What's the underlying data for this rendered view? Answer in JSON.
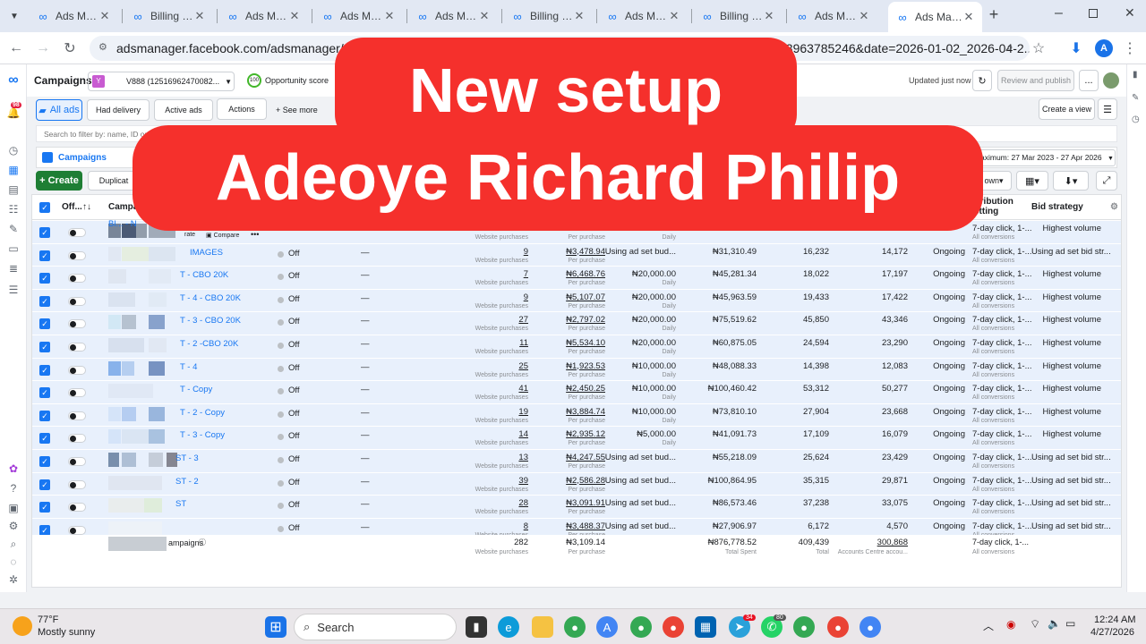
{
  "browser": {
    "tabs": [
      {
        "label": "Ads Manag",
        "icon": "meta-icon",
        "active": false
      },
      {
        "label": "Billing & p",
        "icon": "meta-icon",
        "active": false
      },
      {
        "label": "Ads Manag",
        "icon": "meta-icon",
        "active": false
      },
      {
        "label": "Ads Manag",
        "icon": "meta-icon",
        "active": false
      },
      {
        "label": "Ads Manag",
        "icon": "meta-icon",
        "active": false
      },
      {
        "label": "Billing & p",
        "icon": "meta-icon",
        "active": false
      },
      {
        "label": "Ads Manag",
        "icon": "meta-icon",
        "active": false
      },
      {
        "label": "Billing & p",
        "icon": "meta-icon",
        "active": false
      },
      {
        "label": "Ads Manag",
        "icon": "meta-icon",
        "active": false
      },
      {
        "label": "Ads Mana",
        "icon": "meta-icon",
        "active": true
      }
    ],
    "url": "adsmanager.facebook.com/adsmanager/manage/",
    "url_tail": "23963785246&date=2026-01-02_2026-04-2...",
    "profile_initial": "A"
  },
  "header": {
    "title": "Campaigns",
    "account_badge": "Y",
    "account": "V888 (12516962470082...",
    "opportunity_score_value": "100",
    "opportunity_score_label": "Opportunity score",
    "updated": "Updated just now",
    "review_publish": "Review and publish",
    "more": "..."
  },
  "toolbar": {
    "all_ads": "All ads",
    "had_delivery": "Had delivery",
    "active_ads": "Active ads",
    "actions": "Actions",
    "see_more": "See more",
    "create_view": "Create a view",
    "search_placeholder": "Search to filter by: name, ID or m",
    "campaigns_tab": "Campaigns",
    "date_range": "aximum: 27 Mar 2023 - 27 Apr 2026",
    "create": "Create",
    "duplicate": "Duplicat",
    "breakdown": "own"
  },
  "table": {
    "headers": {
      "off": "Off...",
      "campaign": "Campaig",
      "attribution_1": "ttribution",
      "attribution_2": "etting",
      "bid_strategy": "Bid strategy"
    },
    "rows": [
      {
        "name": "Bl... - N",
        "delivery": "",
        "results": "",
        "results_sub": "Website purchases",
        "cpr": "",
        "cpr_sub": "Per purchase",
        "budget": "",
        "budget_sub": "Daily",
        "spent": "",
        "impr": "",
        "reach": "",
        "ends": "",
        "attribution": "7-day click, 1-...",
        "attr_sub": "All conversions",
        "bid": "Highest volume",
        "hover": true,
        "compare": "Compare",
        "duplicate_hint": "rate"
      },
      {
        "name": "IMAGES",
        "delivery": "Off",
        "results": "9",
        "results_sub": "Website purchases",
        "cpr": "₦3,478.94",
        "cpr_sub": "Per purchase",
        "budget": "Using ad set bud...",
        "budget_sub": "",
        "spent": "₦31,310.49",
        "impr": "16,232",
        "reach": "14,172",
        "ends": "Ongoing",
        "attribution": "7-day click, 1-...",
        "attr_sub": "All conversions",
        "bid": "Using ad set bid str..."
      },
      {
        "name": "T - CBO 20K",
        "delivery": "Off",
        "results": "7",
        "results_sub": "Website purchases",
        "cpr": "₦6,468.76",
        "cpr_sub": "Per purchase",
        "budget": "₦20,000.00",
        "budget_sub": "Daily",
        "spent": "₦45,281.34",
        "impr": "18,022",
        "reach": "17,197",
        "ends": "Ongoing",
        "attribution": "7-day click, 1-...",
        "attr_sub": "All conversions",
        "bid": "Highest volume"
      },
      {
        "name": "T - 4 - CBO 20K",
        "delivery": "Off",
        "results": "9",
        "results_sub": "Website purchases",
        "cpr": "₦5,107.07",
        "cpr_sub": "Per purchase",
        "budget": "₦20,000.00",
        "budget_sub": "Daily",
        "spent": "₦45,963.59",
        "impr": "19,433",
        "reach": "17,422",
        "ends": "Ongoing",
        "attribution": "7-day click, 1-...",
        "attr_sub": "All conversions",
        "bid": "Highest volume"
      },
      {
        "name": "T - 3 - CBO 20K",
        "delivery": "Off",
        "results": "27",
        "results_sub": "Website purchases",
        "cpr": "₦2,797.02",
        "cpr_sub": "Per purchase",
        "budget": "₦20,000.00",
        "budget_sub": "Daily",
        "spent": "₦75,519.62",
        "impr": "45,850",
        "reach": "43,346",
        "ends": "Ongoing",
        "attribution": "7-day click, 1-...",
        "attr_sub": "All conversions",
        "bid": "Highest volume"
      },
      {
        "name": "T - 2 -CBO 20K",
        "delivery": "Off",
        "results": "11",
        "results_sub": "Website purchases",
        "cpr": "₦5,534.10",
        "cpr_sub": "Per purchase",
        "budget": "₦20,000.00",
        "budget_sub": "Daily",
        "spent": "₦60,875.05",
        "impr": "24,594",
        "reach": "23,290",
        "ends": "Ongoing",
        "attribution": "7-day click, 1-...",
        "attr_sub": "All conversions",
        "bid": "Highest volume"
      },
      {
        "name": "T - 4",
        "delivery": "Off",
        "results": "25",
        "results_sub": "Website purchases",
        "cpr": "₦1,923.53",
        "cpr_sub": "Per purchase",
        "budget": "₦10,000.00",
        "budget_sub": "Daily",
        "spent": "₦48,088.33",
        "impr": "14,398",
        "reach": "12,083",
        "ends": "Ongoing",
        "attribution": "7-day click, 1-...",
        "attr_sub": "All conversions",
        "bid": "Highest volume"
      },
      {
        "name": "T - Copy",
        "delivery": "Off",
        "results": "41",
        "results_sub": "Website purchases",
        "cpr": "₦2,450.25",
        "cpr_sub": "Per purchase",
        "budget": "₦10,000.00",
        "budget_sub": "Daily",
        "spent": "₦100,460.42",
        "impr": "53,312",
        "reach": "50,277",
        "ends": "Ongoing",
        "attribution": "7-day click, 1-...",
        "attr_sub": "All conversions",
        "bid": "Highest volume"
      },
      {
        "name": "T - 2 - Copy",
        "delivery": "Off",
        "results": "19",
        "results_sub": "Website purchases",
        "cpr": "₦3,884.74",
        "cpr_sub": "Per purchase",
        "budget": "₦10,000.00",
        "budget_sub": "Daily",
        "spent": "₦73,810.10",
        "impr": "27,904",
        "reach": "23,668",
        "ends": "Ongoing",
        "attribution": "7-day click, 1-...",
        "attr_sub": "All conversions",
        "bid": "Highest volume"
      },
      {
        "name": "T - 3 - Copy",
        "delivery": "Off",
        "results": "14",
        "results_sub": "Website purchases",
        "cpr": "₦2,935.12",
        "cpr_sub": "Per purchase",
        "budget": "₦5,000.00",
        "budget_sub": "Daily",
        "spent": "₦41,091.73",
        "impr": "17,109",
        "reach": "16,079",
        "ends": "Ongoing",
        "attribution": "7-day click, 1-...",
        "attr_sub": "All conversions",
        "bid": "Highest volume"
      },
      {
        "name": "ST - 3",
        "delivery": "Off",
        "results": "13",
        "results_sub": "Website purchases",
        "cpr": "₦4,247.55",
        "cpr_sub": "Per purchase",
        "budget": "Using ad set bud...",
        "budget_sub": "",
        "spent": "₦55,218.09",
        "impr": "25,624",
        "reach": "23,429",
        "ends": "Ongoing",
        "attribution": "7-day click, 1-...",
        "attr_sub": "All conversions",
        "bid": "Using ad set bid str..."
      },
      {
        "name": "ST - 2",
        "delivery": "Off",
        "results": "39",
        "results_sub": "Website purchases",
        "cpr": "₦2,586.28",
        "cpr_sub": "Per purchase",
        "budget": "Using ad set bud...",
        "budget_sub": "",
        "spent": "₦100,864.95",
        "impr": "35,315",
        "reach": "29,871",
        "ends": "Ongoing",
        "attribution": "7-day click, 1-...",
        "attr_sub": "All conversions",
        "bid": "Using ad set bid str..."
      },
      {
        "name": "ST",
        "delivery": "Off",
        "results": "28",
        "results_sub": "Website purchases",
        "cpr": "₦3,091.91",
        "cpr_sub": "Per purchase",
        "budget": "Using ad set bud...",
        "budget_sub": "",
        "spent": "₦86,573.46",
        "impr": "37,238",
        "reach": "33,075",
        "ends": "Ongoing",
        "attribution": "7-day click, 1-...",
        "attr_sub": "All conversions",
        "bid": "Using ad set bid str..."
      },
      {
        "name": "",
        "delivery": "Off",
        "results": "8",
        "results_sub": "Website purchases",
        "cpr": "₦3,488.37",
        "cpr_sub": "Per purchase",
        "budget": "Using ad set bud...",
        "budget_sub": "",
        "spent": "₦27,906.97",
        "impr": "6,172",
        "reach": "4,570",
        "ends": "Ongoing",
        "attribution": "7-day click, 1-...",
        "attr_sub": "All conversions",
        "bid": "Using ad set bid str..."
      }
    ],
    "totals": {
      "name": "ampaigns",
      "results": "282",
      "results_sub": "Website purchases",
      "cpr": "₦3,109.14",
      "cpr_sub": "Per purchase",
      "spent": "₦876,778.52",
      "spent_sub": "Total Spent",
      "impr": "409,439",
      "impr_sub": "Total",
      "reach": "300,868",
      "reach_sub": "Accounts Centre accou...",
      "attribution": "7-day click, 1-...",
      "attr_sub": "All conversions"
    }
  },
  "overlay": {
    "line1": "New setup",
    "line2": "Adeoye Richard Philip",
    "color": "#f5302c"
  },
  "taskbar": {
    "weather_temp": "77°F",
    "weather_desc": "Mostly sunny",
    "search": "Search",
    "time": "12:24 AM",
    "date": "4/27/2026",
    "badge_98": "98",
    "badge_80": "80",
    "badge_34": "34"
  }
}
